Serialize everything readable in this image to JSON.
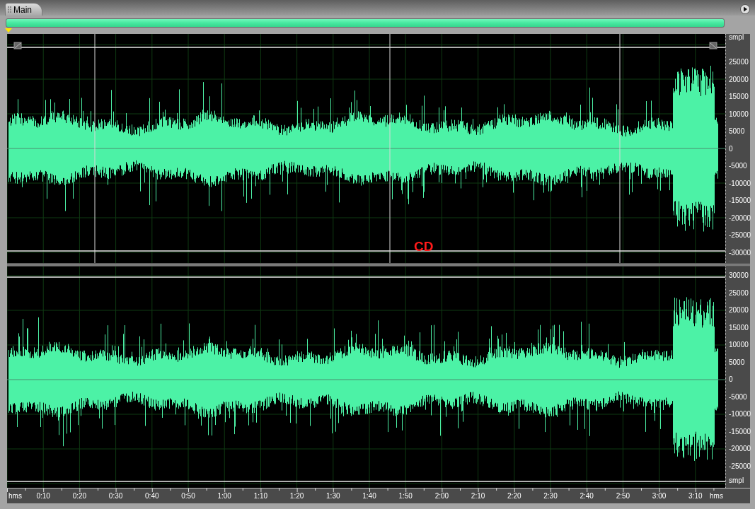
{
  "tab": {
    "label": "Main",
    "selected": true
  },
  "channels": [
    {
      "kind": "upper",
      "unit": "smpl",
      "scale": [
        "25000",
        "20000",
        "15000",
        "10000",
        "5000",
        "0",
        "-5000",
        "-10000",
        "-15000",
        "-20000",
        "-25000",
        "-30000"
      ],
      "label": "CD"
    },
    {
      "kind": "lower",
      "unit": "smpl",
      "scale": [
        "30000",
        "25000",
        "20000",
        "15000",
        "10000",
        "5000",
        "0",
        "-5000",
        "-10000",
        "-15000",
        "-20000",
        "-25000"
      ]
    }
  ],
  "time_ruler": {
    "unit_left": "hms",
    "ticks": [
      "0:10",
      "0:20",
      "0:30",
      "0:40",
      "0:50",
      "1:00",
      "1:10",
      "1:20",
      "1:30",
      "1:40",
      "1:50",
      "2:00",
      "2:10",
      "2:20",
      "2:30",
      "2:40",
      "2:50",
      "3:00",
      "3:10"
    ],
    "unit_right": "hms"
  }
}
